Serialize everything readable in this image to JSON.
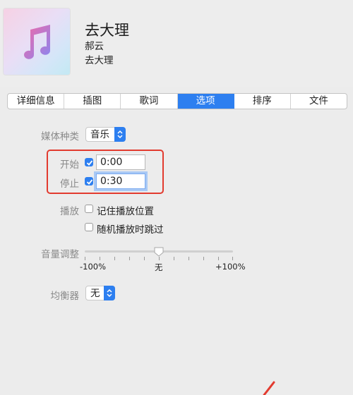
{
  "header": {
    "title": "去大理",
    "artist": "郝云",
    "album": "去大理",
    "art_icon": "music-note-icon"
  },
  "tabs": [
    {
      "label": "详细信息",
      "active": false
    },
    {
      "label": "插图",
      "active": false
    },
    {
      "label": "歌词",
      "active": false
    },
    {
      "label": "选项",
      "active": true
    },
    {
      "label": "排序",
      "active": false
    },
    {
      "label": "文件",
      "active": false
    }
  ],
  "options": {
    "media_kind_label": "媒体种类",
    "media_kind_value": "音乐",
    "start_label": "开始",
    "start_checked": true,
    "start_value": "0:00",
    "stop_label": "停止",
    "stop_checked": true,
    "stop_value": "0:30",
    "playback_label": "播放",
    "remember_position_label": "记住播放位置",
    "remember_position_checked": false,
    "skip_shuffle_label": "随机播放时跳过",
    "skip_shuffle_checked": false,
    "volume_label": "音量调整",
    "volume_min": "-100%",
    "volume_mid": "无",
    "volume_max": "+100%",
    "volume_value": 0,
    "eq_label": "均衡器",
    "eq_value": "无"
  },
  "colors": {
    "accent": "#2d7ff0",
    "highlight_box": "#e23b2f"
  }
}
